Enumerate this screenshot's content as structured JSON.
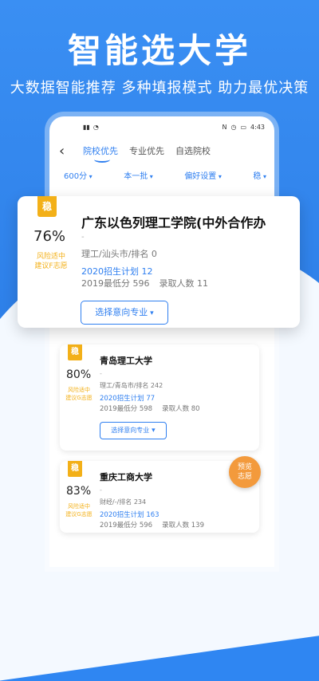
{
  "promo": {
    "headline": "智能选大学",
    "subline": "大数据智能推荐 多种填报模式 助力最优决策"
  },
  "status_bar": {
    "time": "4:43"
  },
  "nav": {
    "back_icon": "chevron-left-icon",
    "tabs": [
      "院校优先",
      "专业优先",
      "自选院校"
    ],
    "active_tab": "院校优先"
  },
  "filters": [
    "600分",
    "本一批",
    "偏好设置",
    "稳"
  ],
  "cards": [
    {
      "badge": "稳",
      "probability": "76%",
      "risk_line1": "风险适中",
      "risk_line2": "建议F志愿",
      "name": "广东以色列理工学院(中外合作办",
      "dash": "-",
      "info": "理工/汕头市/排名 0",
      "plan": "2020招生计划  12",
      "min_score": "2019最低分 596",
      "admitted": "录取人数  11",
      "pick_label": "选择意向专业"
    },
    {
      "badge": "稳",
      "probability": "80%",
      "risk_line1": "风险适中",
      "risk_line2": "建议G志愿",
      "name": "青岛理工大学",
      "dash": "-",
      "info": "理工/青岛市/排名 242",
      "plan": "2020招生计划  77",
      "min_score": "2019最低分 598",
      "admitted": "录取人数  80",
      "pick_label": "选择意向专业"
    },
    {
      "badge": "稳",
      "probability": "83%",
      "risk_line1": "风险适中",
      "risk_line2": "建议G志愿",
      "name": "重庆工商大学",
      "dash": "-",
      "info": "财经/-/排名 234",
      "plan": "2020招生计划  163",
      "min_score": "2019最低分 596",
      "admitted": "录取人数  139"
    }
  ],
  "preview_button": {
    "line1": "预览",
    "line2": "志愿"
  },
  "colors": {
    "accent": "#2f7ff0",
    "badge": "#f3b018",
    "preview": "#f39a3c"
  }
}
